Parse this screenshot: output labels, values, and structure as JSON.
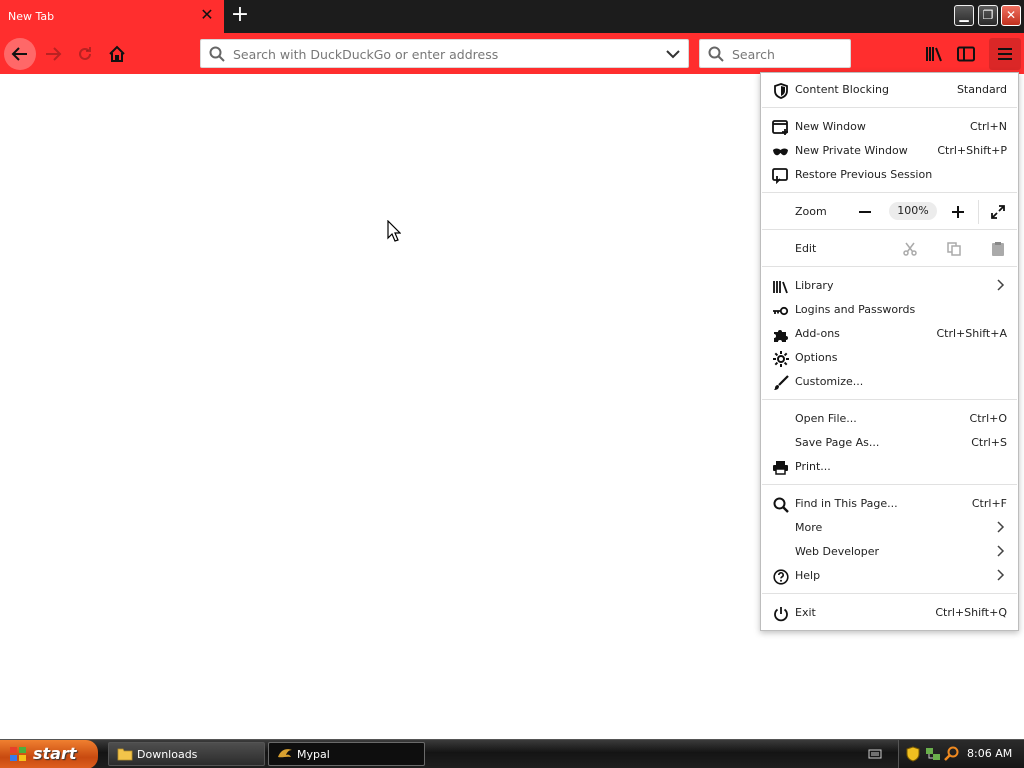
{
  "tabs": [
    {
      "title": "New Tab"
    }
  ],
  "navbar": {
    "url_placeholder": "Search with DuckDuckGo or enter address",
    "search_placeholder": "Search"
  },
  "menu": {
    "content_blocking": {
      "label": "Content Blocking",
      "value": "Standard"
    },
    "new_window": {
      "label": "New Window",
      "shortcut": "Ctrl+N"
    },
    "new_private_window": {
      "label": "New Private Window",
      "shortcut": "Ctrl+Shift+P"
    },
    "restore_session": {
      "label": "Restore Previous Session"
    },
    "zoom": {
      "label": "Zoom",
      "value": "100%"
    },
    "edit": {
      "label": "Edit"
    },
    "library": {
      "label": "Library"
    },
    "logins": {
      "label": "Logins and Passwords"
    },
    "addons": {
      "label": "Add-ons",
      "shortcut": "Ctrl+Shift+A"
    },
    "options": {
      "label": "Options"
    },
    "customize": {
      "label": "Customize..."
    },
    "open_file": {
      "label": "Open File...",
      "shortcut": "Ctrl+O"
    },
    "save_page": {
      "label": "Save Page As...",
      "shortcut": "Ctrl+S"
    },
    "print": {
      "label": "Print..."
    },
    "find": {
      "label": "Find in This Page...",
      "shortcut": "Ctrl+F"
    },
    "more": {
      "label": "More"
    },
    "web_developer": {
      "label": "Web Developer"
    },
    "help": {
      "label": "Help"
    },
    "exit": {
      "label": "Exit",
      "shortcut": "Ctrl+Shift+Q"
    }
  },
  "taskbar": {
    "start_label": "start",
    "tasks": [
      {
        "label": "Downloads"
      },
      {
        "label": "Mypal"
      }
    ],
    "clock": "8:06 AM"
  },
  "colors": {
    "toolbar_accent": "#ff2e2e",
    "tabstrip": "#1c1c1c",
    "taskbar": "#1a1a1a",
    "start_button": "#e06020"
  }
}
